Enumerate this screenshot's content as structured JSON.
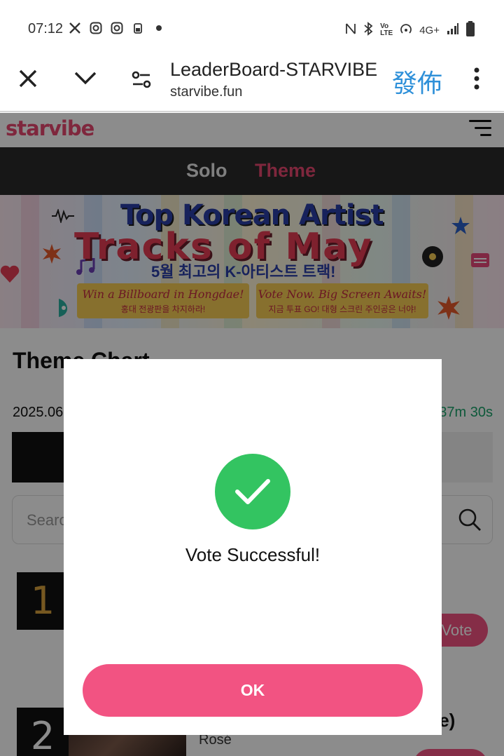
{
  "status_bar": {
    "time": "07:12",
    "network": "4G+",
    "icons_left": [
      "x-app-icon",
      "instagram-icon",
      "instagram-icon",
      "battery-saver-icon",
      "dot-icon"
    ],
    "icons_right": [
      "nfc-icon",
      "bluetooth-icon",
      "volte-icon",
      "hotspot-icon",
      "signal-icon",
      "battery-icon"
    ]
  },
  "browser": {
    "title": "LeaderBoard-STARVIBE",
    "url": "starvibe.fun",
    "publish_label": "發佈"
  },
  "site": {
    "logo": "starvibe",
    "tabs": [
      {
        "label": "Solo",
        "active": false
      },
      {
        "label": "Theme",
        "active": true
      }
    ],
    "banner": {
      "title_line1": "Top Korean Artist",
      "title_line2": "Tracks of May",
      "subtitle": "5월 최고의 K-아티스트 트랙!",
      "box1_main": "Win a Billboard in Hongdae!",
      "box1_sub": "홍대 전광판을 차지하라!",
      "box2_main": "Vote Now. Big Screen Awaits!",
      "box2_sub": "지금 투표 GO! 대형 스크린 주인공은 너야!"
    },
    "section_title": "Theme Chart",
    "date": "2025.06",
    "countdown": "37m 30s",
    "search_placeholder": "Search",
    "entries": [
      {
        "rank": "1",
        "vote_label": "Vote"
      },
      {
        "rank": "2",
        "title_tail": "ie)",
        "artist": "Rosé"
      }
    ]
  },
  "modal": {
    "message": "Vote Successful!",
    "ok_label": "OK"
  },
  "colors": {
    "accent_pink": "#f25382",
    "success_green": "#33c461",
    "publish_blue": "#2e90d9",
    "countdown_green": "#1aa36b"
  }
}
